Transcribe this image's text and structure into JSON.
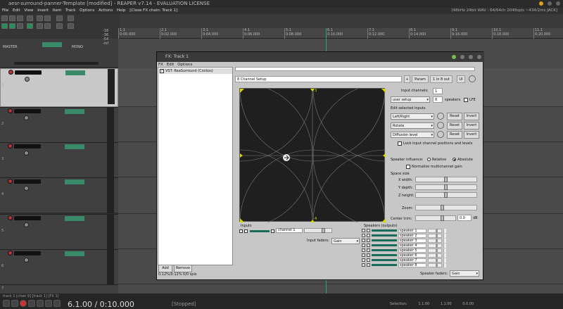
{
  "app": {
    "title": "aesr-surround-panner-Template [modified] - REAPER v7.14 - EVALUATION LICENSE",
    "status_right": "[48kHz 24bit WAV : 64/64ch 2048spls ~434/2ms JACK]",
    "menu": [
      "File",
      "Edit",
      "View",
      "Insert",
      "Item",
      "Track",
      "Options",
      "Actions",
      "Help"
    ],
    "menu_extra": "[Close FX chain: Track 1]"
  },
  "master": {
    "label": "MASTER",
    "mono_label": "MONO",
    "meter_labels": [
      "-18",
      "-36",
      "-54",
      "-inf"
    ]
  },
  "tracks": [
    {
      "num": "1"
    },
    {
      "num": "2"
    },
    {
      "num": "3"
    },
    {
      "num": "4"
    },
    {
      "num": "5"
    },
    {
      "num": "6"
    },
    {
      "num": "7"
    }
  ],
  "ruler": {
    "marks": [
      {
        "bar": "1.1",
        "time": "0:00.000"
      },
      {
        "bar": "2.1",
        "time": "0:02.000"
      },
      {
        "bar": "3.1",
        "time": "0:04.000"
      },
      {
        "bar": "4.1",
        "time": "0:06.000"
      },
      {
        "bar": "5.1",
        "time": "0:08.000"
      },
      {
        "bar": "6.1",
        "time": "0:10.000"
      },
      {
        "bar": "7.1",
        "time": "0:12.000"
      },
      {
        "bar": "8.1",
        "time": "0:14.000"
      },
      {
        "bar": "9.1",
        "time": "0:16.000"
      },
      {
        "bar": "10.1",
        "time": "0:18.000"
      },
      {
        "bar": "11.1",
        "time": "0:20.000"
      }
    ]
  },
  "transport": {
    "timeline_label": "track 1 [chan 9] [track 1] [FX 1]",
    "position": "6.1.00 / 0:10.000",
    "status": "[Stopped]",
    "selection_label": "Selection:",
    "sel_start": "1.1.00",
    "sel_end": "1.1.00",
    "sel_len": "0.0.00"
  },
  "fx": {
    "title": "FX: Track 1",
    "menu": [
      "FX",
      "Edit",
      "Options"
    ],
    "plugin": "VST: ReaSurround (Cockos)",
    "add": "Add",
    "remove": "Remove",
    "status": "0.12%/0.12% 0/0 spls",
    "preset": "8 Channel Setup",
    "plus": "+",
    "param": "Param",
    "io": "1 in 8 out",
    "ui": "UI",
    "input_channels_label": "Input channels:",
    "input_channels_value": "1",
    "user_setup": "user setup",
    "speakers_value": "8",
    "speakers_label": "speakers",
    "lfe_label": "LFE",
    "edit_selected": "Edit selected inputs",
    "lr": "Left/Right",
    "rotate": "Rotate",
    "diffusion": "Diffusion level",
    "reset": "Reset",
    "invert": "Invert",
    "lock": "Lock input channel positions and levels",
    "influence_label": "Speaker influence:",
    "relative": "Relative",
    "absolute": "Absolute",
    "normalize": "Normalize multichannel gain",
    "space_size": "Space size",
    "x_width": "X width:",
    "y_depth": "Y depth:",
    "z_height": "Z height:",
    "zoom": "Zoom:",
    "center_trim": "Center trim:",
    "center_trim_value": "0.0",
    "db": "dB",
    "inputs_label": "Inputs",
    "channel": "channel 1",
    "input_faders_label": "Input faders:",
    "input_faders_value": "Gain",
    "speakers_outputs": "Speakers (outputs)",
    "speakers": [
      "speaker 1",
      "speaker 2",
      "speaker 3",
      "speaker 4",
      "speaker 5",
      "speaker 6",
      "speaker 7",
      "speaker 8"
    ],
    "speaker_faders_label": "Speaker faders:",
    "speaker_faders_value": "Gain",
    "grid_labels": [
      "3",
      "4",
      "5",
      "6",
      "7",
      "8",
      "1",
      "2"
    ]
  }
}
